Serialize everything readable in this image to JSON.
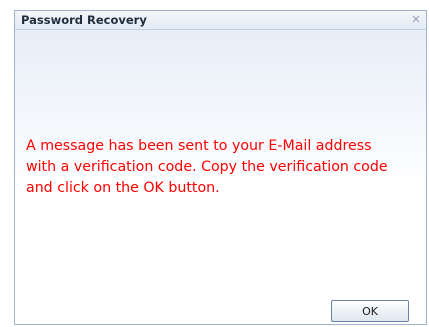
{
  "dialog": {
    "title": "Password Recovery",
    "close_icon": "close-icon",
    "message_lines": [
      "A message has been sent to your E-Mail address",
      "with a verification code. Copy the verification code",
      "and click on the OK button."
    ],
    "ok_label": "OK",
    "message_color": "#ff0000"
  }
}
